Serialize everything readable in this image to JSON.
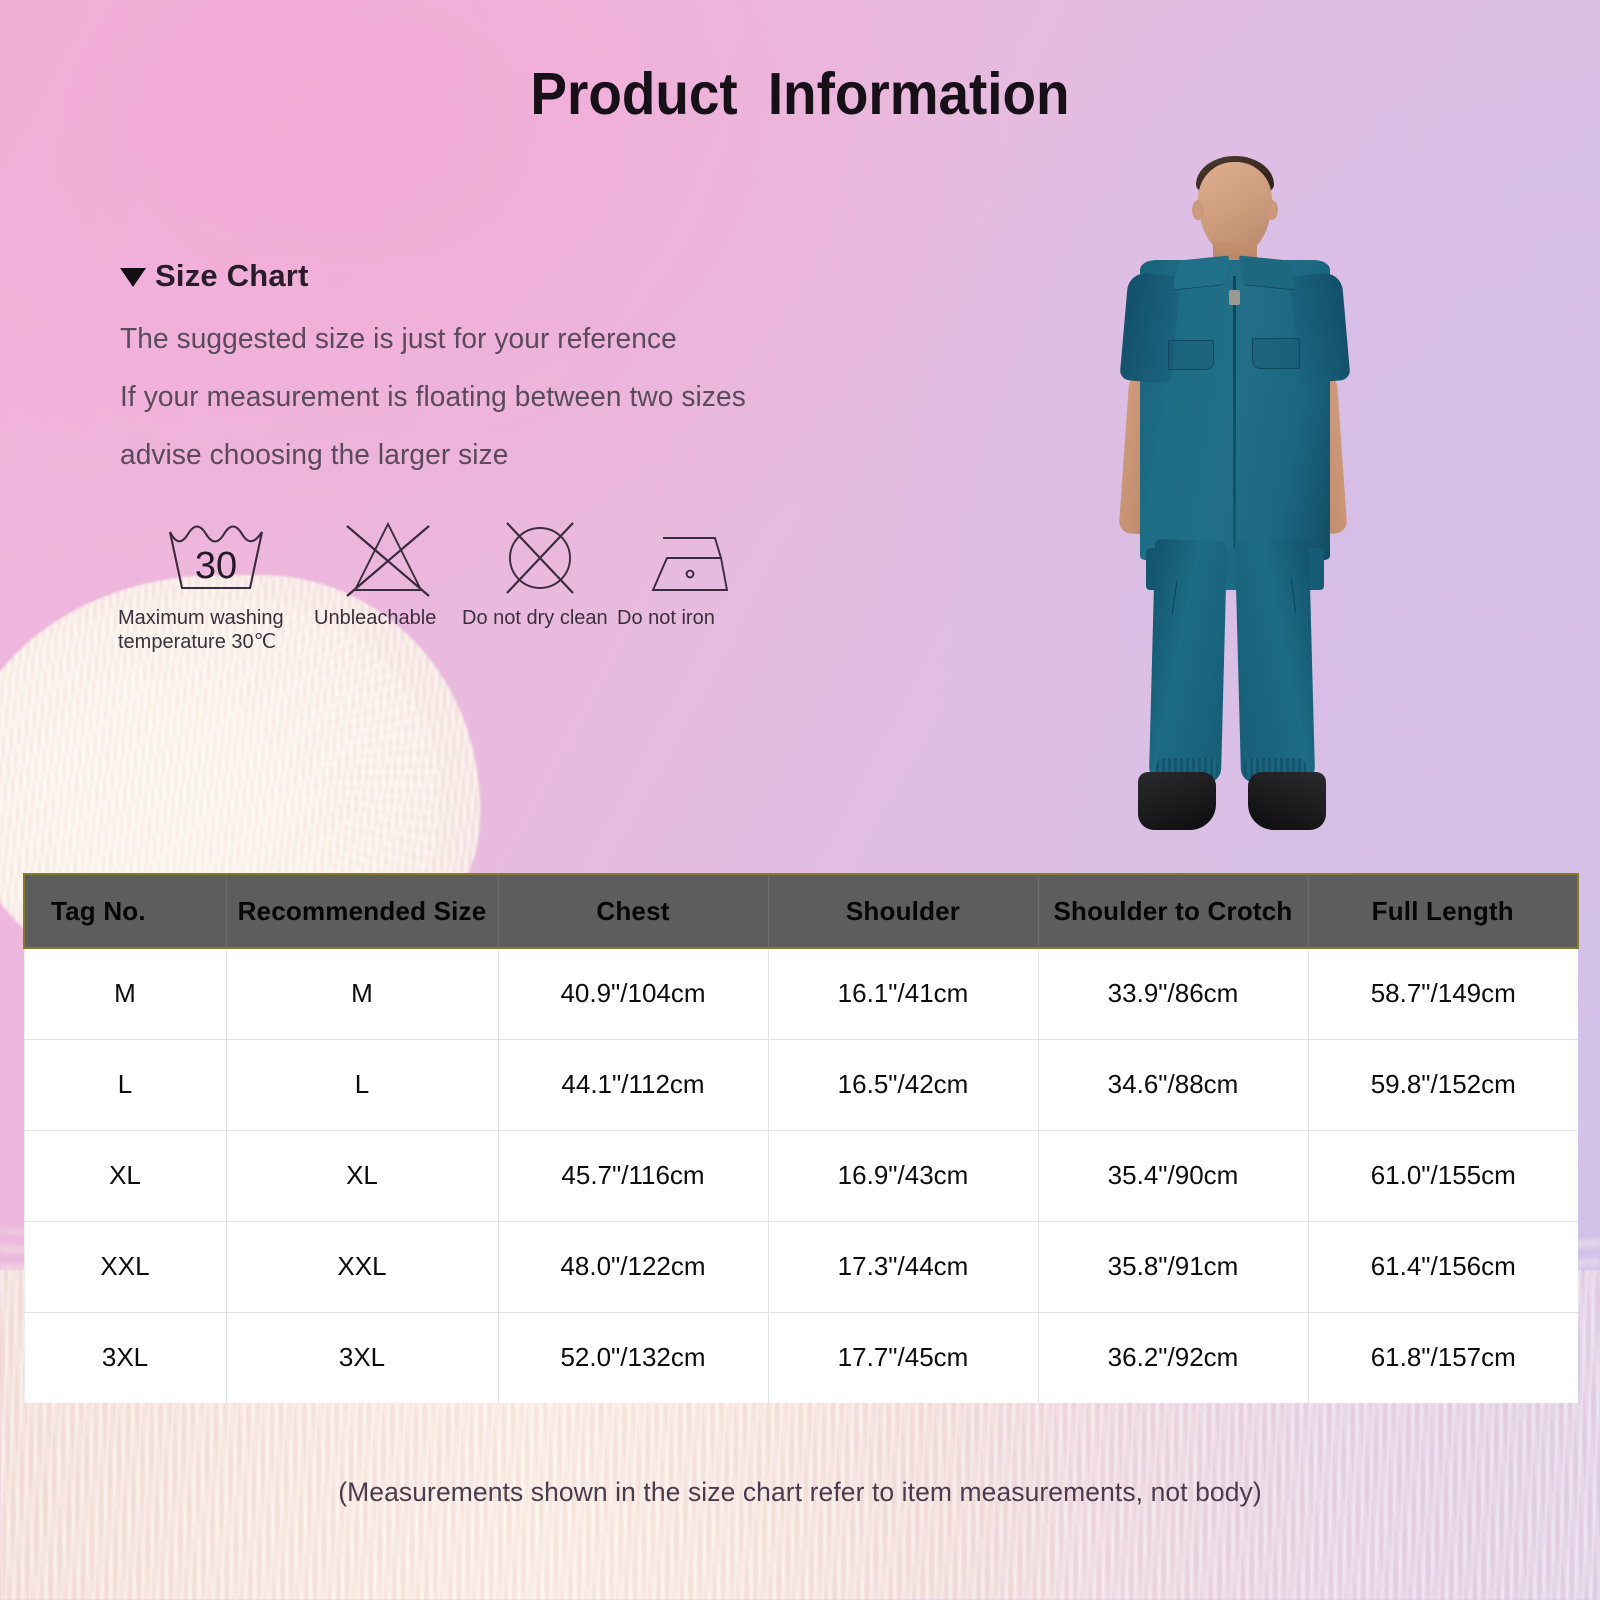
{
  "header": {
    "title": "Product  Information"
  },
  "size_chart": {
    "heading": "Size Chart",
    "marker_icon": "triangle-down-icon",
    "notes": [
      "The suggested size is just for your reference",
      "If your measurement is floating between two sizes",
      "advise choosing the larger size"
    ]
  },
  "care_icons": [
    {
      "id": "wash-30-icon",
      "label": "Maximum washing\ntemperature 30℃",
      "value": "30"
    },
    {
      "id": "no-bleach-icon",
      "label": "Unbleachable"
    },
    {
      "id": "no-dry-clean-icon",
      "label": "Do not dry clean"
    },
    {
      "id": "no-iron-icon",
      "label": "Do not iron"
    }
  ],
  "product_image": {
    "alt": "Male model wearing teal short-sleeve zip-front jumpsuit with black boots",
    "garment_color": "#1d6b84",
    "boot_color": "#131315"
  },
  "chart_data": {
    "type": "table",
    "title": "Size Chart",
    "columns": [
      "Tag No.",
      "Recommended Size",
      "Chest",
      "Shoulder",
      "Shoulder to Crotch",
      "Full Length"
    ],
    "rows": [
      [
        "M",
        "M",
        "40.9\"/104cm",
        "16.1\"/41cm",
        "33.9\"/86cm",
        "58.7\"/149cm"
      ],
      [
        "L",
        "L",
        "44.1\"/112cm",
        "16.5\"/42cm",
        "34.6\"/88cm",
        "59.8\"/152cm"
      ],
      [
        "XL",
        "XL",
        "45.7\"/116cm",
        "16.9\"/43cm",
        "35.4\"/90cm",
        "61.0\"/155cm"
      ],
      [
        "XXL",
        "XXL",
        "48.0\"/122cm",
        "17.3\"/44cm",
        "35.8\"/91cm",
        "61.4\"/156cm"
      ],
      [
        "3XL",
        "3XL",
        "52.0\"/132cm",
        "17.7\"/45cm",
        "36.2\"/92cm",
        "61.8\"/157cm"
      ]
    ],
    "header_bg": "#5d5d5d",
    "header_border": "#8a7b28",
    "body_bg": "#ffffff"
  },
  "footnote": "(Measurements shown in the size chart refer to item measurements, not body)",
  "theme": {
    "bg_pink": "#f0b2da",
    "bg_lavender": "#d0c3ea",
    "text_dark": "#2a1d2a",
    "text_muted": "#5a4a5c"
  }
}
